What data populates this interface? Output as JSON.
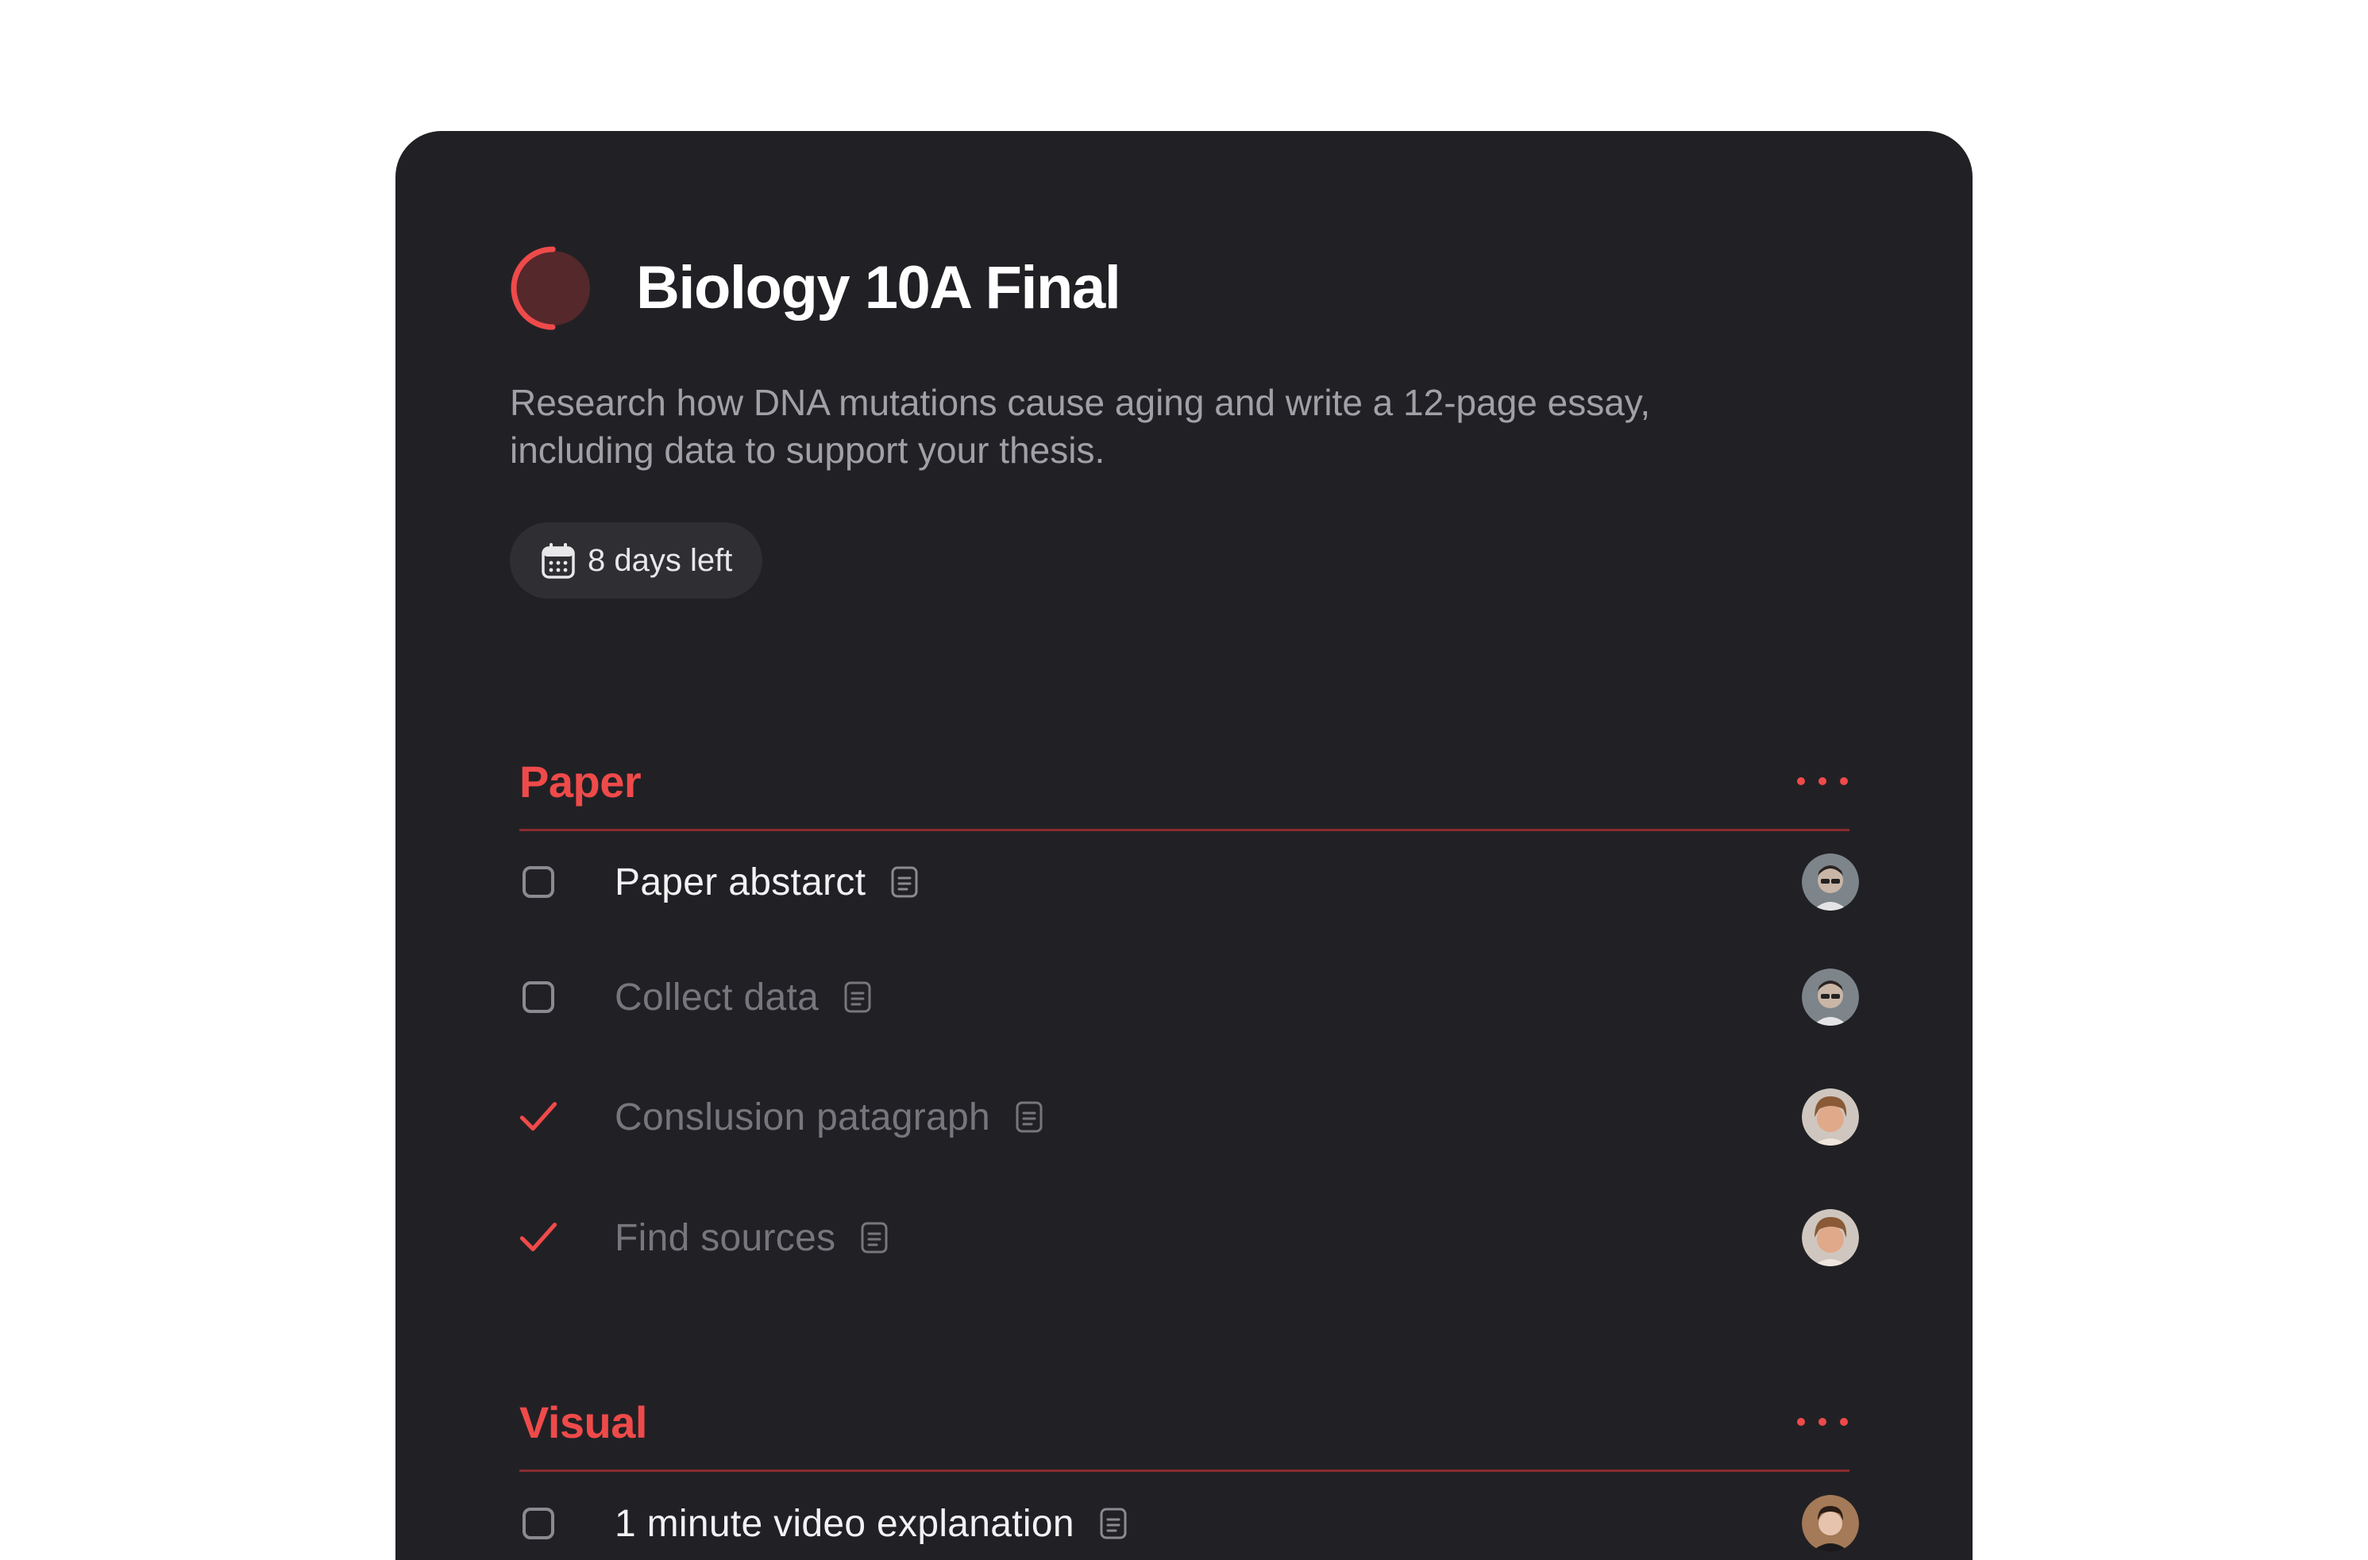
{
  "project": {
    "title": "Biology 10A Final",
    "description": "Research how DNA mutations cause aging and write a 12-page essay, including data to support your thesis.",
    "due_label": "8 days left",
    "progress": 0.5,
    "accent_color": "#ef4a4a"
  },
  "sections": [
    {
      "title": "Paper",
      "tasks": [
        {
          "label": "Paper abstarct",
          "done": false,
          "state": "active"
        },
        {
          "label": "Collect data",
          "done": false,
          "state": "muted"
        },
        {
          "label": "Conslusion patagraph",
          "done": true,
          "state": "muted"
        },
        {
          "label": "Find sources",
          "done": true,
          "state": "muted"
        }
      ]
    },
    {
      "title": "Visual",
      "tasks": [
        {
          "label": "1 minute video explanation",
          "done": false,
          "state": "active"
        }
      ]
    }
  ],
  "icons": {
    "calendar": "calendar-icon",
    "note": "note-icon",
    "more": "more-horizontal-icon",
    "check": "check-icon"
  }
}
